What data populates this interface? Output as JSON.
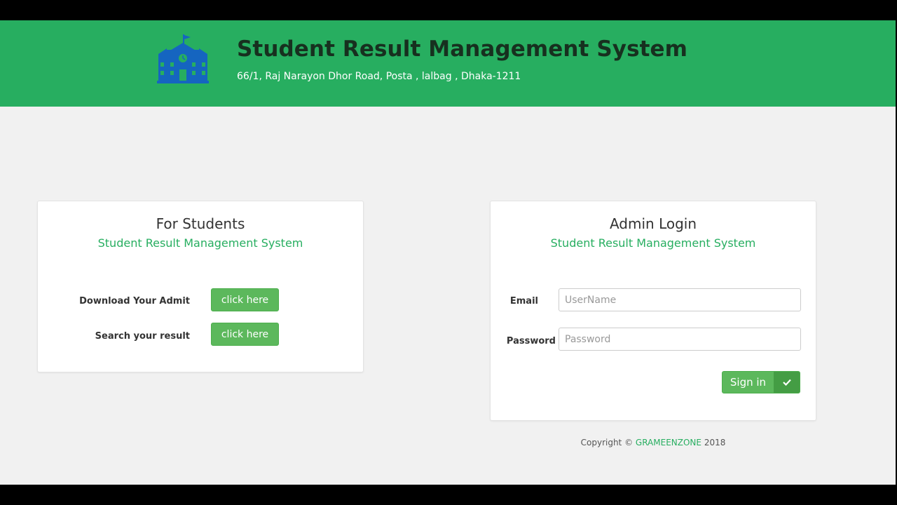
{
  "header": {
    "title": "Student Result Management System",
    "address": "66/1, Raj Narayon Dhor Road, Posta , lalbag , Dhaka-1211",
    "logo_icon": "school-icon",
    "background_color": "#27ae60"
  },
  "students_panel": {
    "title": "For Students",
    "subtitle": "Student Result Management System",
    "rows": [
      {
        "label": "Download Your Admit",
        "button_label": "click here"
      },
      {
        "label": "Search your result",
        "button_label": "click here"
      }
    ]
  },
  "admin_panel": {
    "title": "Admin Login",
    "subtitle": "Student Result Management System",
    "email_label": "Email",
    "email_placeholder": "UserName",
    "password_label": "Password",
    "password_placeholder": "Password",
    "signin_label": "Sign in",
    "signin_icon": "check-icon"
  },
  "footer": {
    "copyright_prefix": "Copyright ©",
    "brand": "GRAMEENZONE",
    "year": "2018"
  },
  "colors": {
    "accent": "#27ae60",
    "button": "#5cb85c",
    "page_background": "#f1f1f1"
  }
}
